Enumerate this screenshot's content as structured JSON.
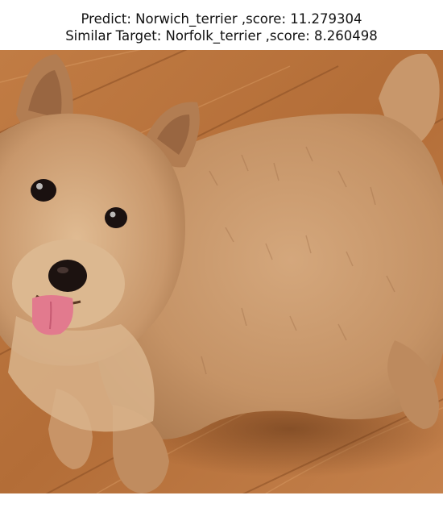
{
  "figure": {
    "title_line_1": "Predict: Norwich_terrier ,score: 11.279304",
    "title_line_2": "Similar Target: Norfolk_terrier ,score: 8.260498"
  },
  "image": {
    "subject": "dog-photo",
    "colors": {
      "floor": "#b9743f",
      "floor_dark": "#8a4f25",
      "fur": "#c9976a",
      "fur_light": "#e2c09a",
      "fur_dark": "#9b6a44",
      "nose": "#1c1210",
      "eye": "#1a1110",
      "tongue": "#e27a8e"
    }
  }
}
